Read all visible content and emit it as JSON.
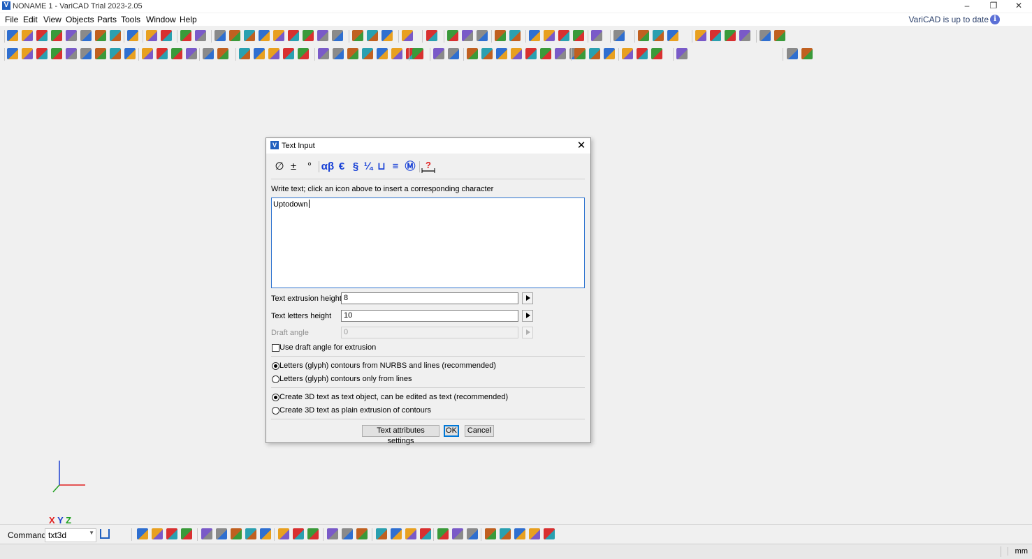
{
  "window": {
    "title": "NONAME 1 - VariCAD Trial 2023-2.05",
    "app_icon": "V",
    "controls": [
      "–",
      "❐",
      "✕"
    ]
  },
  "menu": {
    "items": [
      "File",
      "Edit",
      "View",
      "Objects",
      "Parts",
      "Tools",
      "Window",
      "Help"
    ],
    "update_status": "VariCAD is up to date",
    "info_icon": "i"
  },
  "canvas": {
    "axis_labels": {
      "x": "X",
      "y": "Y",
      "z": "Z"
    },
    "axis_colors": {
      "x": "#e02020",
      "y": "#1a3fd0",
      "z": "#20a020"
    }
  },
  "command_bar": {
    "label": "Command:",
    "value": "txt3d"
  },
  "status_bar": {
    "unit": "mm"
  },
  "dialog": {
    "title": "Text Input",
    "icon": "V",
    "close": "✕",
    "symbols": [
      "∅",
      "±",
      "°",
      "αβ",
      "€",
      "§",
      "¼",
      "⊔",
      "≡",
      "Ⓜ"
    ],
    "instruction": "Write text; click an icon above to insert a corresponding character",
    "text_value": "Uptodown",
    "fields": {
      "extrusion_label": "Text extrusion height",
      "extrusion_value": "8",
      "letters_label": "Text letters height",
      "letters_value": "10",
      "draft_label": "Draft angle",
      "draft_value": "0"
    },
    "use_draft_label": "Use draft angle for extrusion",
    "use_draft_checked": false,
    "contour_options": [
      {
        "label": "Letters (glyph) contours from NURBS and lines (recommended)",
        "checked": true
      },
      {
        "label": "Letters (glyph) contours only from lines",
        "checked": false
      }
    ],
    "create_options": [
      {
        "label": "Create 3D text as text object, can be edited as text (recommended)",
        "checked": true
      },
      {
        "label": "Create 3D text as plain extrusion of contours",
        "checked": false
      }
    ],
    "buttons": {
      "attributes": "Text attributes settings",
      "ok": "OK",
      "cancel": "Cancel"
    }
  }
}
